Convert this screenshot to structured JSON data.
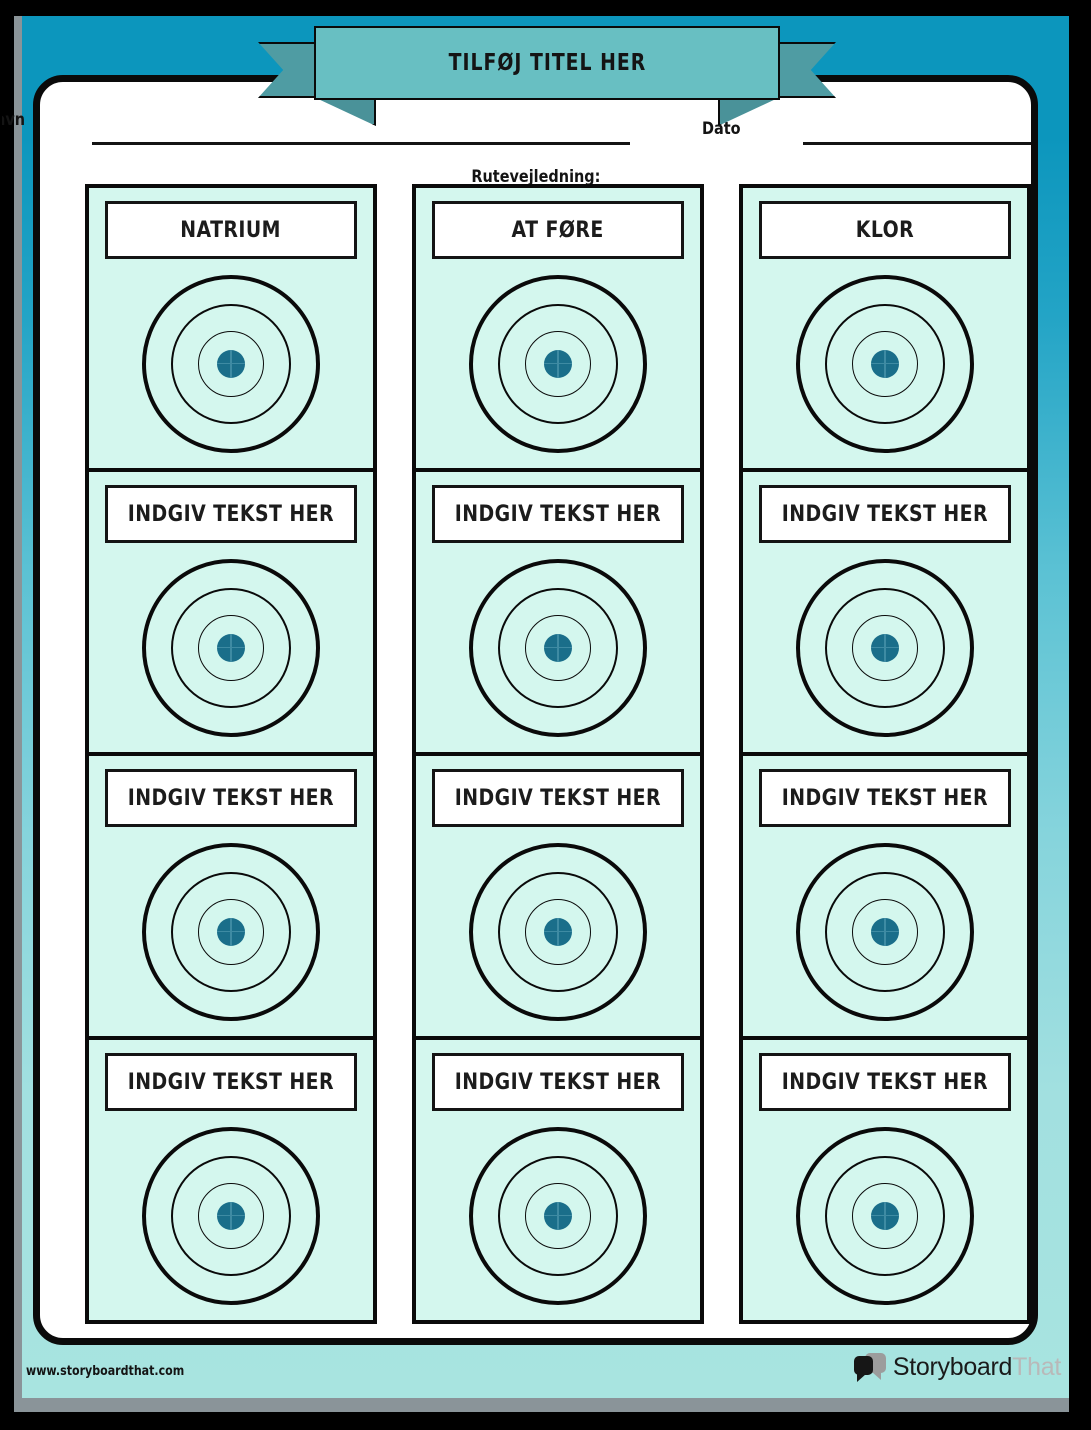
{
  "banner": {
    "title": "TILFØJ TITEL HER"
  },
  "header": {
    "name_label": "Navn",
    "date_label": "Dato",
    "directions_label": "Rutevejledning:"
  },
  "colors": {
    "backdrop_top": "#0c96bd",
    "backdrop_bottom": "#a8e4e0",
    "ribbon_body": "#68bfc2",
    "ribbon_tail": "#4f9ca3",
    "cell_background": "#d4f7ee",
    "bullseye": "#1a6e8a",
    "ink": "#0a0a0a"
  },
  "grid": {
    "columns": [
      {
        "cells": [
          {
            "label": "NATRIUM",
            "icon": "bullseye-target-icon"
          },
          {
            "label": "INDGIV TEKST HER",
            "icon": "bullseye-target-icon"
          },
          {
            "label": "INDGIV TEKST HER",
            "icon": "bullseye-target-icon"
          },
          {
            "label": "INDGIV TEKST HER",
            "icon": "bullseye-target-icon"
          }
        ]
      },
      {
        "cells": [
          {
            "label": "AT FØRE",
            "icon": "bullseye-target-icon"
          },
          {
            "label": "INDGIV TEKST HER",
            "icon": "bullseye-target-icon"
          },
          {
            "label": "INDGIV TEKST HER",
            "icon": "bullseye-target-icon"
          },
          {
            "label": "INDGIV TEKST HER",
            "icon": "bullseye-target-icon"
          }
        ]
      },
      {
        "cells": [
          {
            "label": "KLOR",
            "icon": "bullseye-target-icon"
          },
          {
            "label": "INDGIV TEKST HER",
            "icon": "bullseye-target-icon"
          },
          {
            "label": "INDGIV TEKST HER",
            "icon": "bullseye-target-icon"
          },
          {
            "label": "INDGIV TEKST HER",
            "icon": "bullseye-target-icon"
          }
        ]
      }
    ]
  },
  "footer": {
    "url": "www.storyboardthat.com",
    "logo_primary": "Storyboard",
    "logo_secondary": "That"
  }
}
